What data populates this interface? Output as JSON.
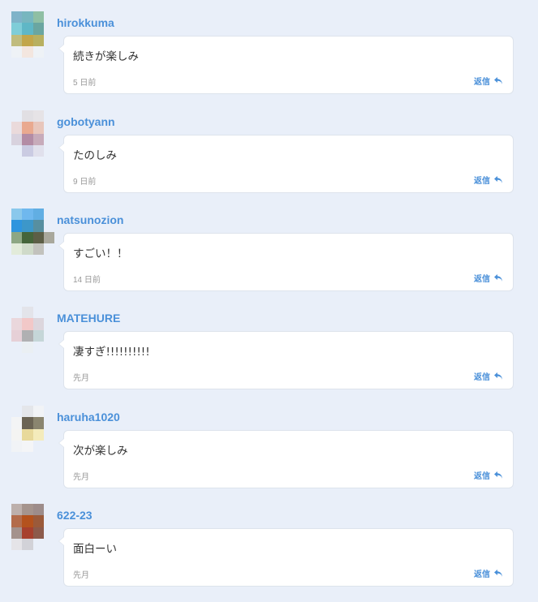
{
  "colors": {
    "accent": "#4a90d9",
    "background": "#e9eff9"
  },
  "comments": [
    {
      "username": "hirokkuma",
      "text": "続きが楽しみ",
      "time": "5 日前",
      "reply_label": "返信",
      "avatar_colors": [
        "#7fb3c9",
        "#78b6bf",
        "#8fbfa4",
        "#e9eff9",
        "#7fcdd8",
        "#5fb7c6",
        "#6aa6a1",
        "#e9eff9",
        "#c0bc7e",
        "#c2a64b",
        "#b8b060",
        "#e9eff9",
        "#eef2f6",
        "#f3e6df",
        "#eef2f6",
        "#e9eff9"
      ]
    },
    {
      "username": "gobotyann",
      "text": "たのしみ",
      "time": "9 日前",
      "reply_label": "返信",
      "avatar_colors": [
        "#e9eff9",
        "#e1dfe3",
        "#e6e3e6",
        "#e9eff9",
        "#eadadb",
        "#e9a98f",
        "#e8c6bb",
        "#e9eff9",
        "#d8d2de",
        "#b38ca5",
        "#c7abba",
        "#e9eff9",
        "#e9eff9",
        "#cacbe2",
        "#e0e0ec",
        "#e9eff9"
      ]
    },
    {
      "username": "natsunozion",
      "text": "すごい！！",
      "time": "14 日前",
      "reply_label": "返信",
      "avatar_colors": [
        "#8ac8ec",
        "#6fb8ee",
        "#61aee3",
        "#e9eff9",
        "#2f95de",
        "#3d97c9",
        "#578fa0",
        "#e9eff9",
        "#8da784",
        "#45653a",
        "#5c5e46",
        "#a9a89c",
        "#e2ebda",
        "#cfdac9",
        "#c2c2bd",
        "#e9eff9"
      ]
    },
    {
      "username": "MATEHURE",
      "text": "凄すぎ!!!!!!!!!!",
      "time": "先月",
      "reply_label": "返信",
      "avatar_colors": [
        "#e9eff9",
        "#e3e4ea",
        "#e9eff9",
        "#e9eff9",
        "#ead7dc",
        "#f2c8c8",
        "#dcd6dd",
        "#e9eff9",
        "#e6d0d7",
        "#b0b0b2",
        "#c5d6d8",
        "#e9eff9",
        "#e9eff9",
        "#eaeff3",
        "#e9eff9",
        "#e9eff9"
      ]
    },
    {
      "username": "haruha1020",
      "text": "次が楽しみ",
      "time": "先月",
      "reply_label": "返信",
      "avatar_colors": [
        "#e9eff9",
        "#e4e6ea",
        "#f1f3f6",
        "#e9eff9",
        "#f3f4f5",
        "#6b6454",
        "#8a856f",
        "#e9eff9",
        "#f4f4f2",
        "#e8d99b",
        "#f4ebbb",
        "#e9eff9",
        "#f1f3f6",
        "#f4f5f7",
        "#e9eff9",
        "#e9eff9"
      ]
    },
    {
      "username": "622-23",
      "text": "面白ーい",
      "time": "先月",
      "reply_label": "返信",
      "avatar_colors": [
        "#bdb0ac",
        "#a5948d",
        "#9d8c8a",
        "#e9eff9",
        "#b36c4b",
        "#b4521d",
        "#9b5a3a",
        "#e9eff9",
        "#a4928d",
        "#a7402e",
        "#8c5a4b",
        "#e9eff9",
        "#e5e4e8",
        "#d2d2d8",
        "#e9eff9",
        "#e9eff9"
      ]
    }
  ]
}
